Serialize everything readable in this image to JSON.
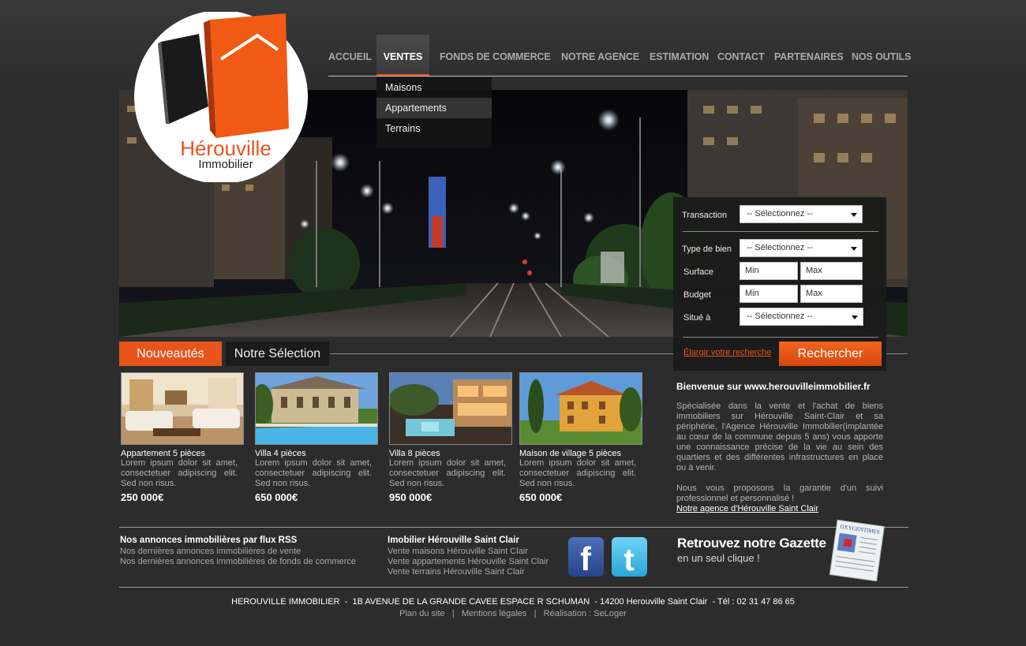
{
  "brand": {
    "name_line1": "Hérouville",
    "name_line2": "Immobilier"
  },
  "nav": {
    "items": [
      {
        "label": "ACCUEIL"
      },
      {
        "label": "VENTES",
        "active": true
      },
      {
        "label": "FONDS DE COMMERCE"
      },
      {
        "label": "NOTRE AGENCE"
      },
      {
        "label": "ESTIMATION"
      },
      {
        "label": "CONTACT"
      },
      {
        "label": "PARTENAIRES"
      },
      {
        "label": "NOS OUTILS"
      }
    ],
    "dropdown": [
      "Maisons",
      "Appartements",
      "Terrains"
    ],
    "dropdown_highlighted": "Appartements"
  },
  "search": {
    "transaction_label": "Transaction",
    "transaction_value": "-- Sélectionnez --",
    "type_label": "Type de bien",
    "type_value": "-- Sélectionnez --",
    "surface_label": "Surface",
    "surface_min": "Min",
    "surface_max": "Max",
    "budget_label": "Budget",
    "budget_min": "Min",
    "budget_max": "Max",
    "situe_label": "Situé à",
    "situe_value": "-- Sélectionnez --",
    "elargir_link": "Élargir votre recherche",
    "submit_label": "Rechercher"
  },
  "tabs": {
    "nouveautes": "Nouveautés",
    "selection": "Notre Sélection"
  },
  "listings": [
    {
      "title": "Appartement 5 pièces",
      "desc": "Lorem ipsum dolor sit amet, consectetuer adipiscing elit. Sed non risus.",
      "price": "250 000€"
    },
    {
      "title": "Villa 4 pièces",
      "desc": "Lorem ipsum dolor sit amet, consectetuer adipiscing elit. Sed non risus.",
      "price": "650 000€"
    },
    {
      "title": "Villa 8 pièces",
      "desc": "Lorem ipsum dolor sit amet, consectetuer adipiscing elit. Sed non risus.",
      "price": "950 000€"
    },
    {
      "title": "Maison de village 5 pièces",
      "desc": "Lorem ipsum dolor sit amet, consectetuer adipiscing elit. Sed non risus.",
      "price": "650 000€"
    }
  ],
  "welcome": {
    "title": "Bienvenue sur www.herouvilleimmobilier.fr",
    "paragraph1": "Spécialisée dans la vente et l'achat de biens immobiliers sur Hérouville Saint-Clair et sa périphérie, l'Agence Hérouville Immobilier(implantée au cœur de la commune depuis 5 ans) vous apporte une connaissance précise de la vie au sein des quartiers et des différentes infrastructures en place ou à venir.",
    "paragraph2": "Nous vous proposons la garantie d'un suivi professionnel et personnalisé !",
    "link": "Notre agence d'Hérouville Saint Clair"
  },
  "footer": {
    "rss_title": "Nos annonces immobilières par flux RSS",
    "rss_links": [
      "Nos dernières annonces immobilières de vente",
      "Nos dernières annonces immobilières de fonds de commerce"
    ],
    "imo_title": "Imobilier Hérouville Saint Clair",
    "imo_links": [
      "Vente maisons Hérouville Saint Clair",
      "Vente appartements Hérouville Saint Clair",
      "Vente terrains Hérouville Saint Clair"
    ],
    "gazette_line1": "Retrouvez notre Gazette",
    "gazette_line2": "en un seul clique !",
    "gazette_paper_title": "OXYGENTIMES",
    "address": "HEROUVILLE IMMOBILIER  -  1B AVENUE DE LA GRANDE CAVEE ESPACE R SCHUMAN  - 14200 Herouville Saint Clair  - Tél : 02 31 47 86 65",
    "plan": "Plan du site",
    "mentions": "Mentions légales",
    "realisation": "Réalisation : SeLoger"
  },
  "colors": {
    "accent": "#e8541c",
    "background": "#2c2c2c"
  },
  "icons": {
    "facebook": "facebook-icon",
    "twitter": "twitter-icon"
  }
}
